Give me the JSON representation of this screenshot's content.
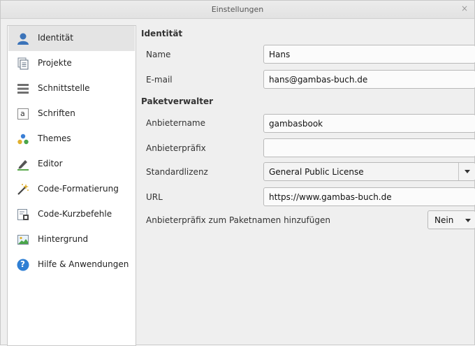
{
  "window": {
    "title": "Einstellungen",
    "close_glyph": "×"
  },
  "sidebar": {
    "items": [
      {
        "label": "Identität",
        "icon": "user-icon",
        "active": true
      },
      {
        "label": "Projekte",
        "icon": "project-icon"
      },
      {
        "label": "Schnittstelle",
        "icon": "interface-icon"
      },
      {
        "label": "Schriften",
        "icon": "font-icon",
        "glyph": "a"
      },
      {
        "label": "Themes",
        "icon": "themes-icon"
      },
      {
        "label": "Editor",
        "icon": "editor-icon"
      },
      {
        "label": "Code-Formatierung",
        "icon": "magic-wand-icon"
      },
      {
        "label": "Code-Kurzbefehle",
        "icon": "shortcuts-icon"
      },
      {
        "label": "Hintergrund",
        "icon": "background-image-icon"
      },
      {
        "label": "Hilfe & Anwendungen",
        "icon": "help-icon",
        "glyph": "?"
      }
    ]
  },
  "identity": {
    "heading": "Identität",
    "name_label": "Name",
    "name_value": "Hans",
    "email_label": "E-mail",
    "email_value": "hans@gambas-buch.de"
  },
  "packager": {
    "heading": "Paketverwalter",
    "vendor_label": "Anbietername",
    "vendor_value": "gambasbook",
    "prefix_label": "Anbieterpräfix",
    "prefix_value": "",
    "license_label": "Standardlizenz",
    "license_value": "General Public License",
    "url_label": "URL",
    "url_value": "https://www.gambas-buch.de",
    "add_prefix_label": "Anbieterpräfix zum Paketnamen hinzufügen",
    "add_prefix_value": "Nein"
  },
  "colors": {
    "accent_blue": "#3a7fd5",
    "user_blue": "#3b73b9",
    "help_blue": "#2f7fd4"
  }
}
